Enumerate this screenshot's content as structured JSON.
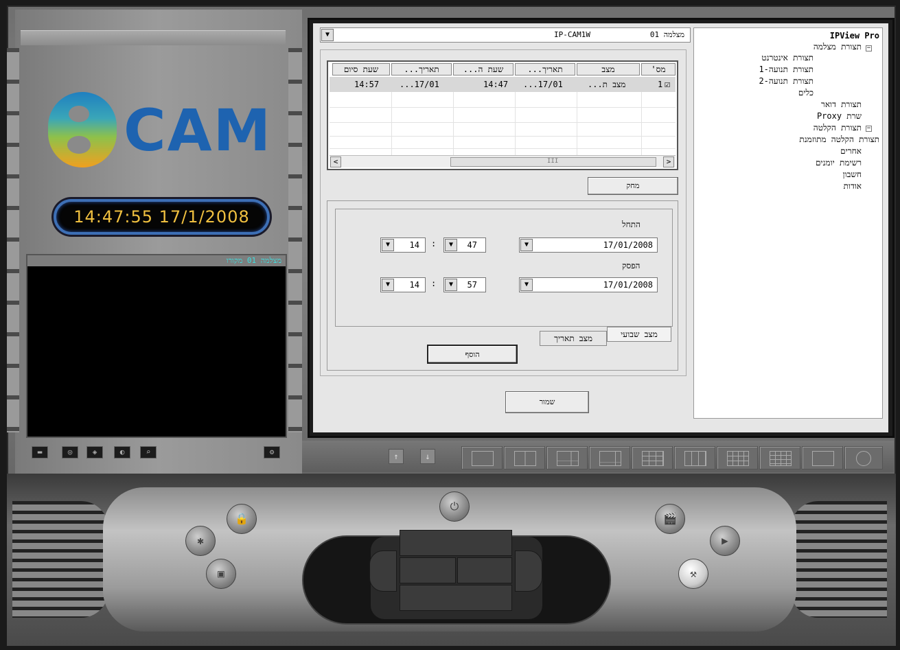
{
  "app": {
    "logo_text": "CAM",
    "clock": "14:47:55 17/1/2008",
    "preview_title": "מצלמה 01 מקורו"
  },
  "camera_selector": {
    "label": "מצלמה 01",
    "model": "IP-CAM1W"
  },
  "tree": {
    "root": "IPView Pro",
    "items": [
      {
        "label": "תצורת מצלמה",
        "level": 1,
        "expander": "−"
      },
      {
        "label": "תצורת אינטרנט",
        "level": 2
      },
      {
        "label": "תצורת תנועה-1",
        "level": 2
      },
      {
        "label": "תצורת תנועה-2",
        "level": 2
      },
      {
        "label": "כלים",
        "level": 2
      },
      {
        "label": "תצורת דואר",
        "level": 1
      },
      {
        "label": "שרת Proxy",
        "level": 1
      },
      {
        "label": "תצורת הקלטה",
        "level": 1,
        "expander": "−"
      },
      {
        "label": "תצורת הקלטה מתוזמנת",
        "level": 2
      },
      {
        "label": "אחרים",
        "level": 1
      },
      {
        "label": "רשימת יומנים",
        "level": 1
      },
      {
        "label": "חשבון",
        "level": 1
      },
      {
        "label": "אודות",
        "level": 1
      }
    ]
  },
  "schedule_table": {
    "columns": [
      "מס'",
      "מצב",
      "תאריך...",
      "שעת ה...",
      "תאריך...",
      "שעת סיום"
    ],
    "rows": [
      {
        "num": "1",
        "mode": "מצב ת...",
        "start_date": "...17/01",
        "start_time": "14:47",
        "end_date": "...17/01",
        "end_time": "14:57",
        "checked": true
      }
    ],
    "scroll_left": "<",
    "scroll_right": ">",
    "scroll_grip": "III"
  },
  "buttons": {
    "delete": "מחק",
    "add": "הוסף",
    "save": "שמור"
  },
  "tabs": {
    "weekly": "מצב שבועי",
    "by_date": "מצב תאריך"
  },
  "form": {
    "start_label": "התחל",
    "stop_label": "הפסק",
    "start_date": "17/01/2008",
    "start_hour": "14",
    "start_minute": "47",
    "stop_date": "17/01/2008",
    "stop_hour": "14",
    "stop_minute": "57",
    "separator": ":"
  },
  "glyphs": {
    "dropdown": "▼",
    "checkbox": "☑",
    "up": "↑",
    "down": "↓",
    "power": "⏻",
    "lock": "🔒",
    "tools": "⚒",
    "play": "▶",
    "film": "🎬",
    "web": "✱",
    "photo": "▣"
  }
}
